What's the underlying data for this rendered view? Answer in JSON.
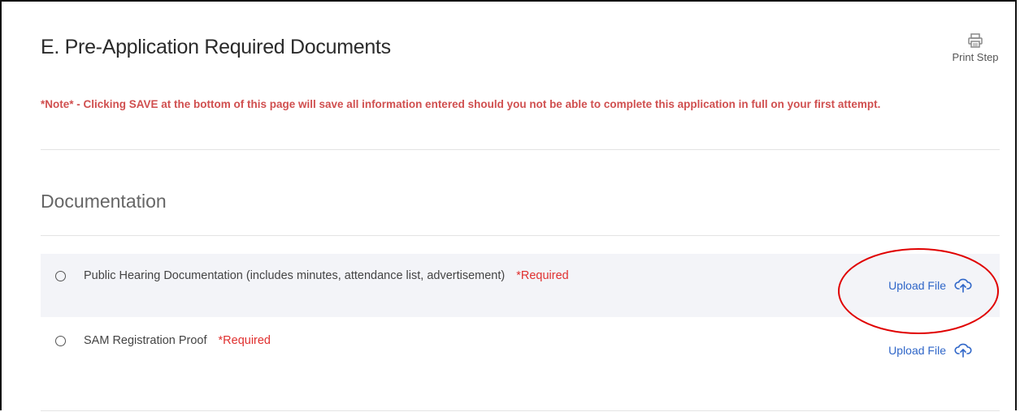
{
  "page": {
    "title": "E. Pre-Application Required Documents",
    "print_label": "Print Step",
    "note": "*Note* - Clicking SAVE at the bottom of this page will save all information entered should you not be able to complete this application in full on your first attempt."
  },
  "section": {
    "title": "Documentation"
  },
  "documents": [
    {
      "label": "Public Hearing Documentation (includes minutes, attendance list, advertisement)",
      "required": "*Required",
      "upload_label": "Upload File"
    },
    {
      "label": "SAM Registration Proof",
      "required": "*Required",
      "upload_label": "Upload File"
    }
  ],
  "colors": {
    "note": "#d04f4f",
    "required": "#e0302f",
    "link": "#2f66c8",
    "row_shade": "#f3f4f8",
    "annotation": "#e00000"
  },
  "icons": {
    "print": "printer-icon",
    "upload": "cloud-upload-icon",
    "radio": "radio-empty"
  }
}
